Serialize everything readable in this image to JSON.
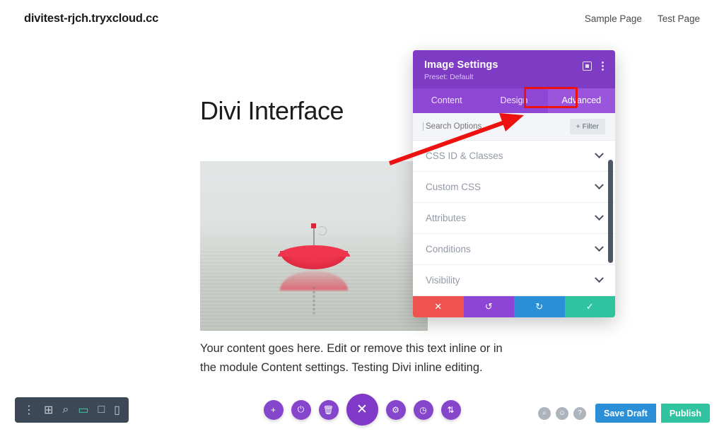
{
  "site": {
    "title": "divitest-rjch.tryxcloud.cc",
    "nav": [
      {
        "label": "Sample Page"
      },
      {
        "label": "Test Page"
      }
    ]
  },
  "main": {
    "heading": "Divi Interface",
    "body_text": "Your content goes here. Edit or remove this text inline or in the module Content settings. Testing Divi inline editing.",
    "image_alt": "red-umbrella-floating-on-water"
  },
  "modal": {
    "title": "Image Settings",
    "preset": "Preset: Default",
    "header_icons": [
      {
        "name": "expand-icon"
      },
      {
        "name": "kebab-menu-icon"
      }
    ],
    "tabs": [
      {
        "label": "Content",
        "active": false
      },
      {
        "label": "Design",
        "active": false
      },
      {
        "label": "Advanced",
        "active": true
      }
    ],
    "highlight_color": "#ee1111",
    "search": {
      "placeholder": "Search Options",
      "value": ""
    },
    "filter_label": "+ Filter",
    "sections": [
      {
        "label": "CSS ID & Classes"
      },
      {
        "label": "Custom CSS"
      },
      {
        "label": "Attributes"
      },
      {
        "label": "Conditions"
      },
      {
        "label": "Visibility"
      }
    ],
    "actions": [
      {
        "name": "cancel",
        "glyph": "✕",
        "color": "#ef5350"
      },
      {
        "name": "undo",
        "glyph": "↺",
        "color": "#8e44d4"
      },
      {
        "name": "redo",
        "glyph": "↻",
        "color": "#2a8fd6"
      },
      {
        "name": "save",
        "glyph": "✓",
        "color": "#2fc3a0"
      }
    ]
  },
  "bottom_left_bar": [
    {
      "name": "kebab-menu-icon",
      "glyph": "⋮",
      "active": false
    },
    {
      "name": "wireframe-icon",
      "glyph": "⊞",
      "active": false
    },
    {
      "name": "zoom-out-icon",
      "glyph": "⌕",
      "active": false
    },
    {
      "name": "desktop-view-icon",
      "glyph": "▭",
      "active": true
    },
    {
      "name": "tablet-view-icon",
      "glyph": "□",
      "active": false
    },
    {
      "name": "phone-view-icon",
      "glyph": "▯",
      "active": false
    }
  ],
  "center_toolbar": [
    {
      "name": "add-icon",
      "glyph": "+",
      "big": false
    },
    {
      "name": "power-icon",
      "glyph": "⏻",
      "big": false
    },
    {
      "name": "trash-icon",
      "glyph": "Ὕ1",
      "big": false
    },
    {
      "name": "close-icon",
      "glyph": "✕",
      "big": true
    },
    {
      "name": "settings-icon",
      "glyph": "⚙",
      "big": false
    },
    {
      "name": "history-icon",
      "glyph": "◴",
      "big": false
    },
    {
      "name": "sort-icon",
      "glyph": "⇅",
      "big": false
    }
  ],
  "bottom_right": {
    "icons": [
      {
        "name": "search-icon",
        "glyph": "⌕"
      },
      {
        "name": "account-icon",
        "glyph": "☺"
      },
      {
        "name": "help-icon",
        "glyph": "?"
      }
    ],
    "save_draft_label": "Save Draft",
    "publish_label": "Publish"
  },
  "colors": {
    "purple_header": "#7e3bc4",
    "purple_tabs": "#8e46d4",
    "accent_green": "#2fc3a0",
    "accent_blue": "#2a8fd6",
    "accent_red": "#ef5350",
    "annotation_red": "#ee1111"
  }
}
